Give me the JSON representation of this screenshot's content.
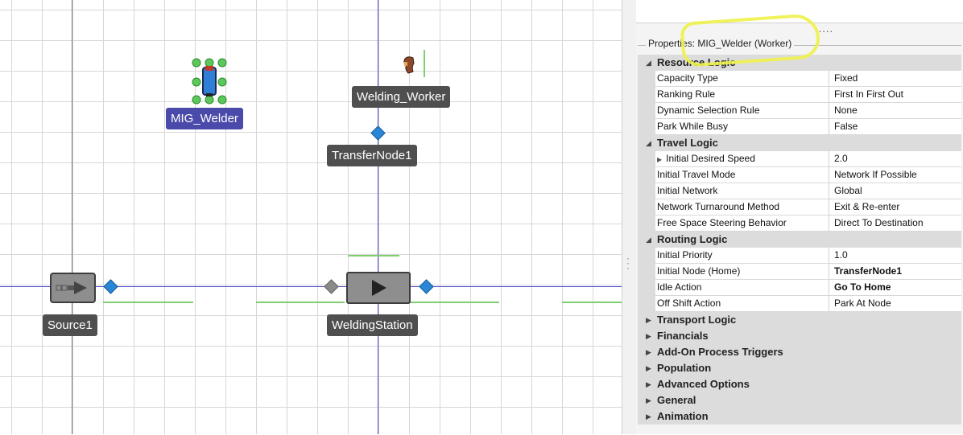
{
  "canvas": {
    "objects": {
      "mig_welder_label": "MIG_Welder",
      "welding_worker_label": "Welding_Worker",
      "transfer_node_label": "TransferNode1",
      "source_label": "Source1",
      "welding_station_label": "WeldingStation"
    }
  },
  "panel": {
    "dots": ".....",
    "properties_title": "Properties: MIG_Welder (Worker)",
    "categories": [
      {
        "label": "Resource Logic",
        "expanded": true,
        "rows": [
          {
            "name": "Capacity Type",
            "value": "Fixed"
          },
          {
            "name": "Ranking Rule",
            "value": "First In First Out"
          },
          {
            "name": "Dynamic Selection Rule",
            "value": "None"
          },
          {
            "name": "Park While Busy",
            "value": "False"
          }
        ]
      },
      {
        "label": "Travel Logic",
        "expanded": true,
        "rows": [
          {
            "name": "Initial Desired Speed",
            "value": "2.0",
            "expandable": true
          },
          {
            "name": "Initial Travel Mode",
            "value": "Network If Possible"
          },
          {
            "name": "Initial Network",
            "value": "Global"
          },
          {
            "name": "Network Turnaround Method",
            "value": "Exit & Re-enter"
          },
          {
            "name": "Free Space Steering Behavior",
            "value": "Direct To Destination"
          }
        ]
      },
      {
        "label": "Routing Logic",
        "expanded": true,
        "rows": [
          {
            "name": "Initial Priority",
            "value": "1.0"
          },
          {
            "name": "Initial Node (Home)",
            "value": "TransferNode1",
            "bold": true
          },
          {
            "name": "Idle Action",
            "value": "Go To Home",
            "bold": true
          },
          {
            "name": "Off Shift Action",
            "value": "Park At Node"
          }
        ]
      },
      {
        "label": "Transport Logic",
        "expanded": false
      },
      {
        "label": "Financials",
        "expanded": false
      },
      {
        "label": "Add-On Process Triggers",
        "expanded": false
      },
      {
        "label": "Population",
        "expanded": false
      },
      {
        "label": "Advanced Options",
        "expanded": false
      },
      {
        "label": "General",
        "expanded": false
      },
      {
        "label": "Animation",
        "expanded": false
      }
    ]
  },
  "colors": {
    "highlight": "#eef24a",
    "selected_label": "#4a4aaa",
    "node_diamond": "#2a86d6",
    "link_line": "#4a4ac8"
  }
}
